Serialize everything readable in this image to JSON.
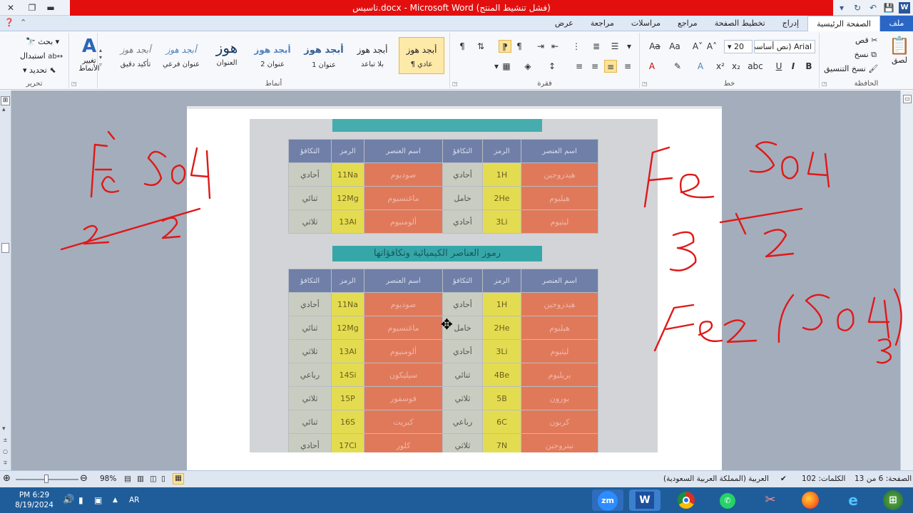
{
  "window": {
    "title": "تاسيس.docx - Microsoft Word (فشل تنشيط المنتج)"
  },
  "tabs": [
    {
      "label": "ملف"
    },
    {
      "label": "الصفحة الرئيسية"
    },
    {
      "label": "إدراج"
    },
    {
      "label": "تخطيط الصفحة"
    },
    {
      "label": "مراجع"
    },
    {
      "label": "مراسلات"
    },
    {
      "label": "مراجعة"
    },
    {
      "label": "عرض"
    }
  ],
  "ribbon": {
    "clipboard": {
      "label": "الحافظة",
      "paste": "لصق",
      "cut": "قص",
      "copy": "نسخ",
      "format_painter": "نسخ التنسيق"
    },
    "font": {
      "label": "خط",
      "font_name": "Arial (نص أساسي)",
      "font_size": "20"
    },
    "paragraph": {
      "label": "فقرة"
    },
    "styles": {
      "label": "أنماط",
      "change_styles": "تغيير الأنماط",
      "items": [
        {
          "preview": "أبجد هوز",
          "name": "¶ عادي"
        },
        {
          "preview": "أبجد هوز",
          "name": "بلا تباعد"
        },
        {
          "preview": "أبجد هوز",
          "name": "عنوان 1"
        },
        {
          "preview": "أبجد هوز",
          "name": "عنوان 2"
        },
        {
          "preview": "هوز",
          "name": "العنوان"
        },
        {
          "preview": "أبجد هوز",
          "name": "عنوان فرعي"
        },
        {
          "preview": "أبجد هوز",
          "name": "تأكيد دقيق"
        }
      ]
    },
    "editing": {
      "label": "تحرير",
      "find": "بحث",
      "replace": "استبدال",
      "select": "تحديد"
    }
  },
  "document": {
    "banner_text": "رموز العناصر الكيميائية وتكافؤاتها",
    "table_headers": [
      "اسم العنصر",
      "الرمز",
      "التكافؤ",
      "اسم العنصر",
      "الرمز",
      "التكافؤ"
    ],
    "table_top": [
      [
        "هيدروجين",
        "1H",
        "أحادي",
        "صوديوم",
        "11Na",
        "أحادي"
      ],
      [
        "هيليوم",
        "2He",
        "خامل",
        "ماغنسيوم",
        "12Mg",
        "ثنائي"
      ],
      [
        "ليثيوم",
        "3Li",
        "أحادي",
        "ألومنيوم",
        "13Al",
        "ثلاثي"
      ]
    ],
    "table_bottom": [
      [
        "هيدروجين",
        "1H",
        "أحادي",
        "صوديوم",
        "11Na",
        "أحادي"
      ],
      [
        "هيليوم",
        "2He",
        "خامل",
        "ماغنسيوم",
        "12Mg",
        "ثنائي"
      ],
      [
        "ليثيوم",
        "3Li",
        "أحادي",
        "ألومنيوم",
        "13Al",
        "ثلاثي"
      ],
      [
        "بريليوم",
        "4Be",
        "ثنائي",
        "سيليكون",
        "14Si",
        "رباعي"
      ],
      [
        "بورون",
        "5B",
        "ثلاثي",
        "فوسفور",
        "15P",
        "ثلاثي"
      ],
      [
        "كربون",
        "6C",
        "رباعي",
        "كبريت",
        "16S",
        "ثنائي"
      ],
      [
        "نيتروجين",
        "7N",
        "ثلاثي",
        "كلور",
        "17Cl",
        "أحادي"
      ]
    ]
  },
  "ink": {
    "left_formula": "Fe SO4",
    "left_valences": "2 2",
    "right_fe": "Fe",
    "right_so4": "SO4",
    "right_fe_valence": "3",
    "right_so4_valence": "2",
    "right_result_main": "Fe2 (SO4)",
    "right_result_sub": "3"
  },
  "statusbar": {
    "page": "الصفحة: 6 من 13",
    "words": "الكلمات: 102",
    "language": "العربية (المملكة العربية السعودية)",
    "zoom": "98%"
  },
  "taskbar": {
    "time": "PM 6:29",
    "date": "8/19/2024",
    "lang": "AR",
    "apps": [
      "zm",
      "W"
    ]
  }
}
